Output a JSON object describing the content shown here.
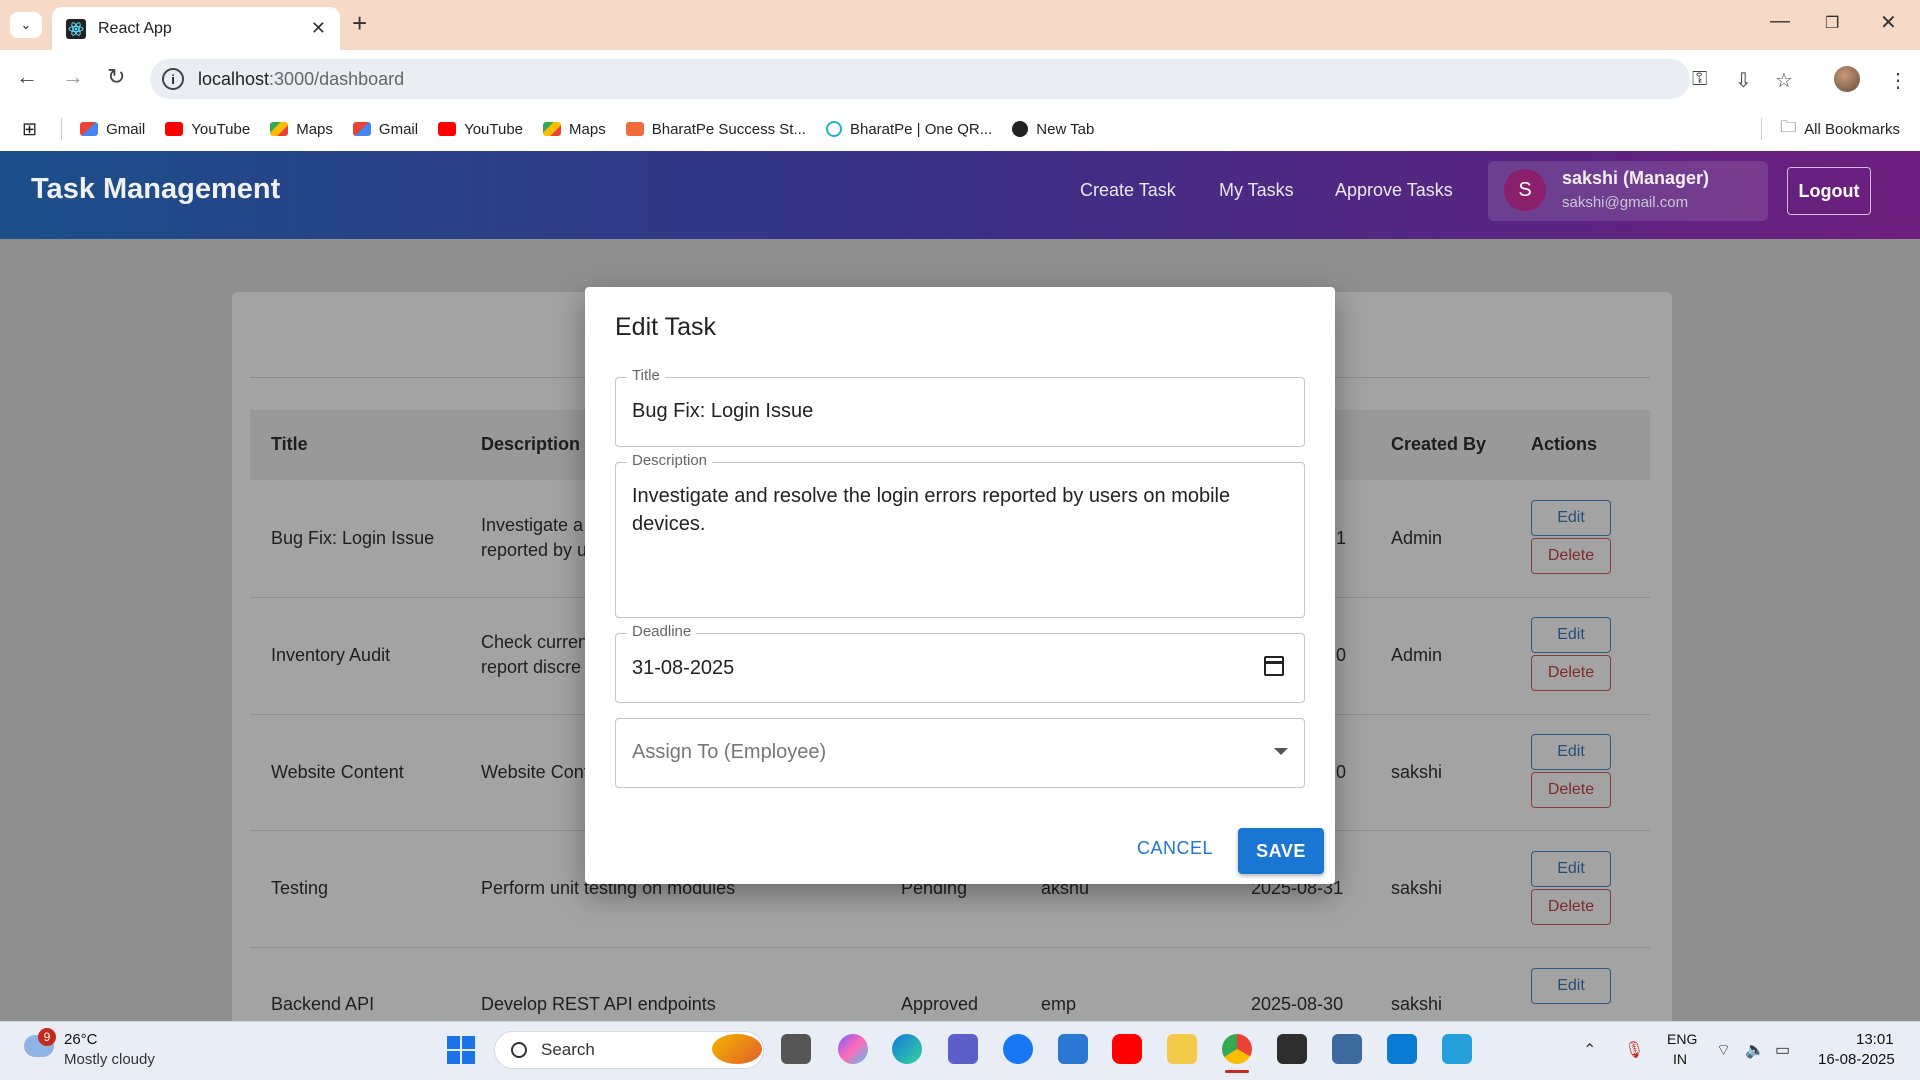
{
  "browser": {
    "tab_title": "React App",
    "url_host": "localhost",
    "url_path": ":3000/dashboard",
    "bookmarks": [
      {
        "label": "Gmail",
        "icon": "gmail-icon"
      },
      {
        "label": "YouTube",
        "icon": "youtube-icon"
      },
      {
        "label": "Maps",
        "icon": "maps-icon"
      },
      {
        "label": "Gmail",
        "icon": "gmail-icon"
      },
      {
        "label": "YouTube",
        "icon": "youtube-icon"
      },
      {
        "label": "Maps",
        "icon": "maps-icon"
      },
      {
        "label": "BharatPe Success St...",
        "icon": "bharatpe-icon"
      },
      {
        "label": "BharatPe | One QR...",
        "icon": "bharatpe-qr-icon"
      },
      {
        "label": "New Tab",
        "icon": "globe-icon"
      }
    ],
    "all_bookmarks": "All Bookmarks"
  },
  "app": {
    "brand": "Task Management",
    "nav": {
      "create": "Create Task",
      "my": "My Tasks",
      "approve": "Approve Tasks"
    },
    "user": {
      "initial": "S",
      "name": "sakshi (Manager)",
      "email": "sakshi@gmail.com"
    },
    "logout": "Logout"
  },
  "table": {
    "headers": {
      "title": "Title",
      "description": "Description",
      "created_by": "Created By",
      "actions": "Actions"
    },
    "rows": [
      {
        "title": "Bug Fix: Login Issue",
        "desc1": "Investigate a",
        "desc2": "reported by u",
        "status": "",
        "assignee": "",
        "deadline": "1",
        "created_by": "Admin"
      },
      {
        "title": "Inventory Audit",
        "desc1": "Check curren",
        "desc2": "report discre",
        "status": "",
        "assignee": "",
        "deadline": "0",
        "created_by": "Admin"
      },
      {
        "title": "Website Content",
        "desc1": "Website Cont",
        "desc2": "",
        "status": "",
        "assignee": "",
        "deadline": "0",
        "created_by": "sakshi"
      },
      {
        "title": "Testing",
        "desc1": "Perform unit testing on modules",
        "desc2": "",
        "status": "Pending",
        "assignee": "akshu",
        "deadline": "2025-08-31",
        "created_by": "sakshi"
      },
      {
        "title": "Backend API",
        "desc1": "Develop REST API endpoints",
        "desc2": "",
        "status": "Approved",
        "assignee": "emp",
        "deadline": "2025-08-30",
        "created_by": "sakshi"
      }
    ],
    "edit_label": "Edit",
    "delete_label": "Delete"
  },
  "modal": {
    "title": "Edit Task",
    "title_label": "Title",
    "title_value": "Bug Fix: Login Issue",
    "desc_label": "Description",
    "desc_line1": "Investigate and resolve the login errors reported by users on mobile",
    "desc_line2": "devices.",
    "deadline_label": "Deadline",
    "deadline_value": "31-08-2025",
    "assign_placeholder": "Assign To (Employee)",
    "cancel": "CANCEL",
    "save": "SAVE"
  },
  "taskbar": {
    "weather_badge": "9",
    "temp": "26°C",
    "condition": "Mostly cloudy",
    "search": "Search",
    "lang1": "ENG",
    "lang2": "IN",
    "time": "13:01",
    "date": "16-08-2025"
  },
  "colors": {
    "primary": "#1976d2",
    "appbar_start": "#1b4f8a",
    "appbar_end": "#6e1e7e"
  }
}
